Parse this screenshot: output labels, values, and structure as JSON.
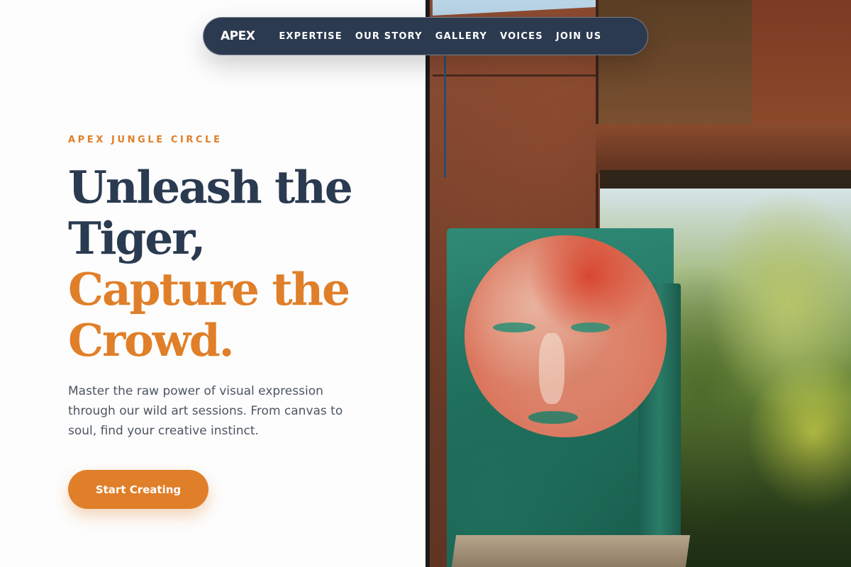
{
  "nav": {
    "brand": "APEX",
    "links": [
      "EXPERTISE",
      "OUR STORY",
      "GALLERY",
      "VOICES",
      "JOIN US"
    ]
  },
  "hero": {
    "eyebrow": "APEX JUNGLE CIRCLE",
    "headline_line1": "Unleash the",
    "headline_line2": "Tiger,",
    "headline_line3": "Capture the",
    "headline_line4": "Crowd.",
    "description": "Master the raw power of visual expression through our wild art sessions. From canvas to soul, find your creative instinct.",
    "cta_label": "Start Creating"
  },
  "colors": {
    "accent": "#e07f29",
    "navy": "#2a3a50",
    "nav_bg": "#2b3a4f",
    "text_muted": "#4d5560"
  }
}
